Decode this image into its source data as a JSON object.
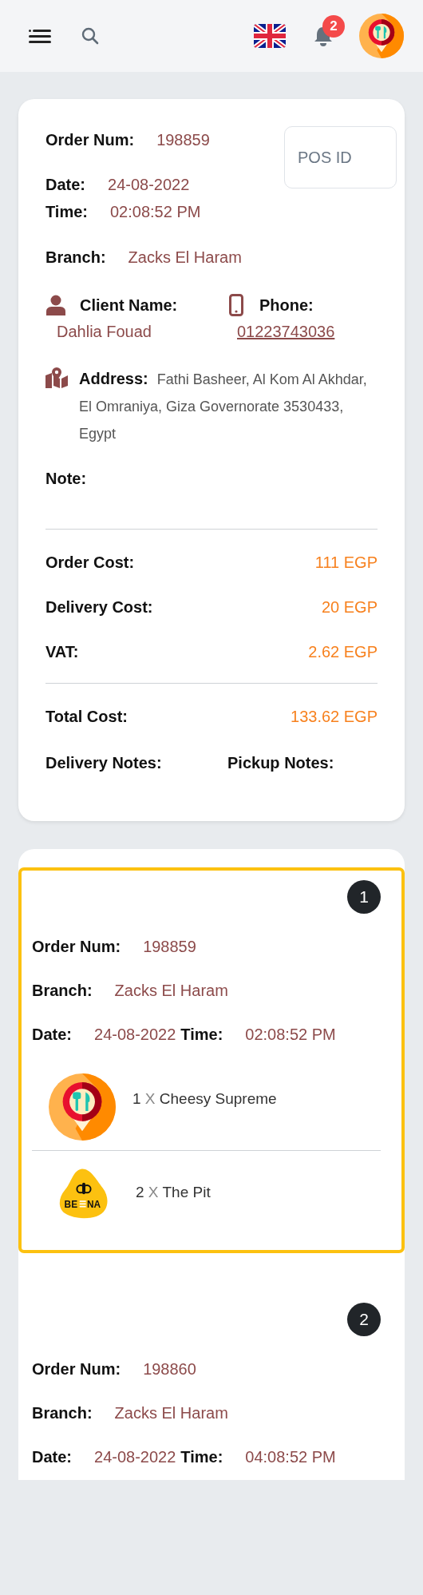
{
  "header": {
    "notification_count": "2"
  },
  "order_details": {
    "order_num": {
      "label": "Order Num:",
      "value": "198859"
    },
    "pos_id": {
      "placeholder": "POS ID"
    },
    "date": {
      "label": "Date:",
      "value": "24-08-2022"
    },
    "time": {
      "label": "Time:",
      "value": "02:08:52 PM"
    },
    "branch": {
      "label": "Branch:",
      "value": "Zacks El Haram"
    },
    "client_name": {
      "label": "Client Name:",
      "value": "Dahlia Fouad"
    },
    "phone": {
      "label": "Phone:",
      "value": "01223743036"
    },
    "address": {
      "text": "**Address:** Fathi Basheer, Al Kom Al Akhdar, El Omraniya, Giza Governorate 3530433, Egypt"
    },
    "note": {
      "label": "Note:"
    },
    "costs": [
      {
        "label": "Order Cost:",
        "value": "111 EGP"
      },
      {
        "label": "Delivery Cost:",
        "value": "20 EGP"
      },
      {
        "label": "VAT:",
        "value": "2.62 EGP"
      }
    ],
    "total": {
      "label": "Total Cost:",
      "value": "133.62 EGP"
    },
    "delivery_notes": {
      "label": "Delivery Notes:"
    },
    "pickup_notes": {
      "label": "Pickup Notes:"
    }
  },
  "orders": [
    {
      "number": "1",
      "selected": true,
      "order_num": {
        "label": "Order Num:",
        "value": "198859"
      },
      "branch": {
        "label": "Branch:",
        "value": "Zacks El Haram"
      },
      "date": {
        "label": "Date:",
        "value": "24-08-2022"
      },
      "time": {
        "label": "Time:",
        "value": "02:08:52 PM"
      },
      "items": [
        {
          "quantity": "1",
          "multiplier": "X",
          "name": "Cheesy Supreme",
          "kind": "pin"
        },
        {
          "quantity": "2",
          "multiplier": "X",
          "name": "The Pit",
          "kind": "bee",
          "logo_text": [
            "BE",
            "NA"
          ]
        }
      ]
    },
    {
      "number": "2",
      "selected": false,
      "order_num": {
        "label": "Order Num:",
        "value": "198860"
      },
      "branch": {
        "label": "Branch:",
        "value": "Zacks El Haram"
      },
      "date": {
        "label": "Date:",
        "value": "24-08-2022"
      },
      "time": {
        "label": "Time:",
        "value": "04:08:52 PM"
      }
    }
  ]
}
